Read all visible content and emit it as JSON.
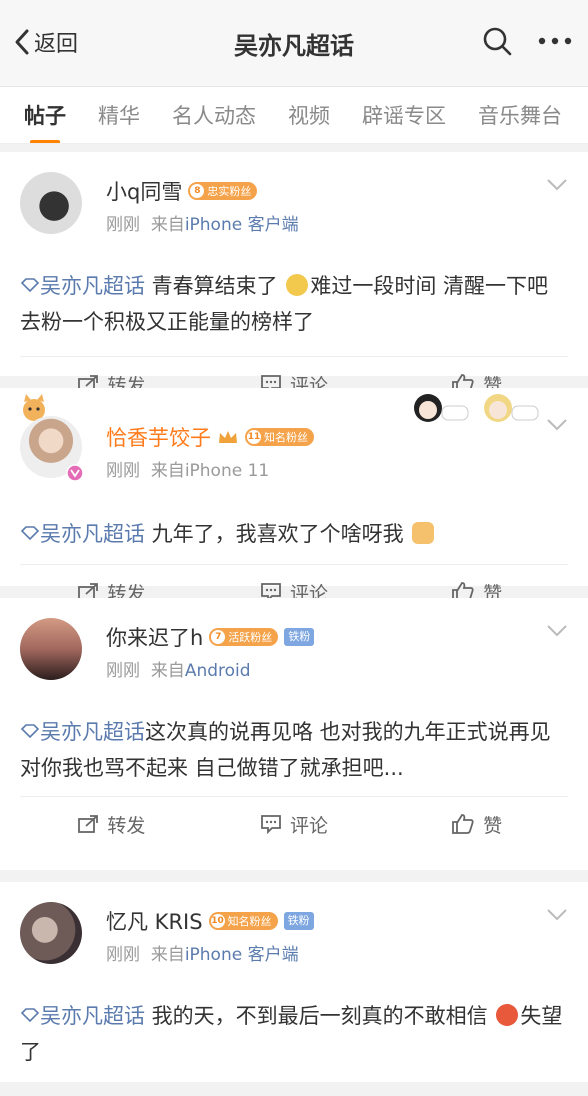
{
  "nav": {
    "back_label": "返回",
    "title": "吴亦凡超话"
  },
  "tabs": [
    {
      "label": "帖子",
      "active": true
    },
    {
      "label": "精华"
    },
    {
      "label": "名人动态"
    },
    {
      "label": "视频"
    },
    {
      "label": "辟谣专区"
    },
    {
      "label": "音乐舞台"
    }
  ],
  "colors": {
    "accent": "#ff8200",
    "link": "#5b7bae",
    "badge": "#f5a34a"
  },
  "posts": [
    {
      "user": "小q同雪",
      "badge_level": "8",
      "badge": "忠实粉丝",
      "time": "刚刚",
      "from": "来自",
      "source": "iPhone 客户端",
      "topic": "吴亦凡超话",
      "text1": " 青春算结束了 ",
      "text2": "难过一段时间 清醒一下吧 去粉一个积极又正能量的榜样了",
      "repost": "转发",
      "comment": "评论",
      "like": "赞"
    },
    {
      "user": "恰香芋饺子",
      "badge_level": "11",
      "badge": "知名粉丝",
      "time": "刚刚",
      "from": "来自",
      "source": "iPhone 11",
      "topic": "吴亦凡超话",
      "text1": " 九年了，我喜欢了个啥呀我 ",
      "repost": "转发",
      "comment": "评论",
      "like": "赞"
    },
    {
      "user": "你来迟了h",
      "badge_level": "7",
      "badge": "活跃粉丝",
      "tiefen": "铁粉",
      "time": "刚刚",
      "from": "来自",
      "source": "Android",
      "topic": "吴亦凡超话",
      "text1": "这次真的说再见咯  也对我的九年正式说再见  对你我也骂不起来  自己做错了就承担吧...",
      "repost": "转发",
      "comment": "评论",
      "like": "赞"
    },
    {
      "user": "忆凡 KRIS",
      "badge_level": "10",
      "badge": "知名粉丝",
      "tiefen": "铁粉",
      "time": "刚刚",
      "from": "来自",
      "source": "iPhone 客户端",
      "topic": "吴亦凡超话",
      "text1": " 我的天，不到最后一刻真的不敢相信 ",
      "text2": "失望了"
    }
  ]
}
